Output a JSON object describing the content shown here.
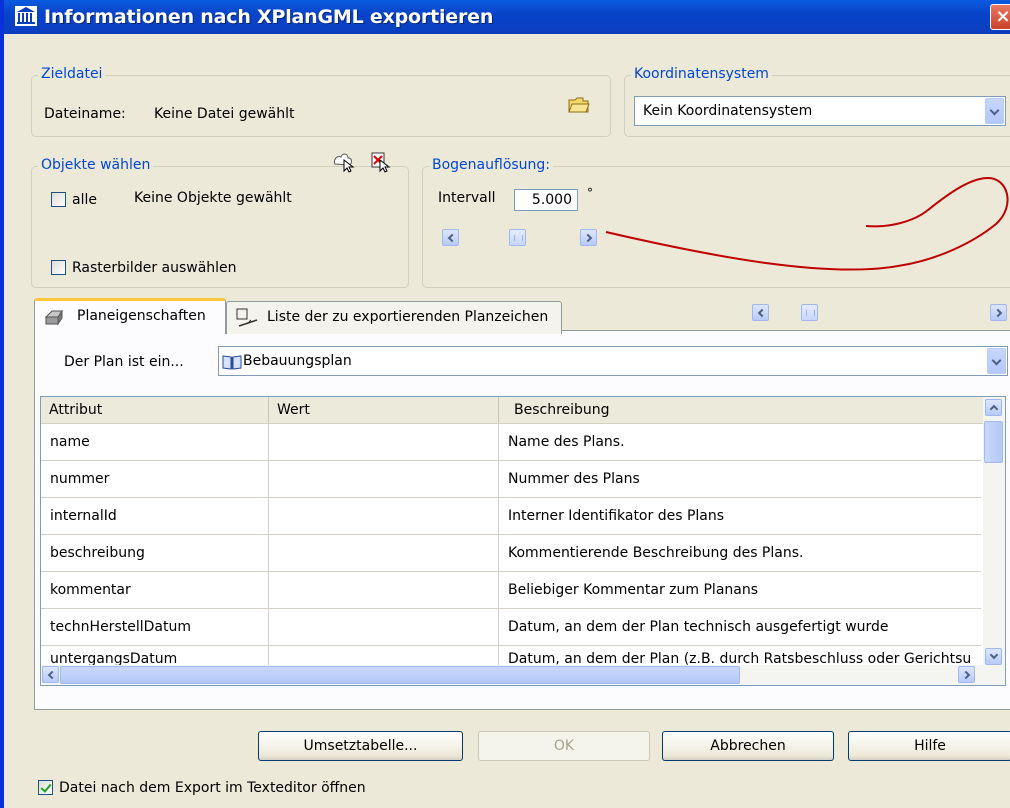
{
  "window": {
    "title": "Informationen nach XPlanGML exportieren",
    "close_label": "×"
  },
  "zieldatei": {
    "group_title": "Zieldatei",
    "dateiname_label": "Dateiname:",
    "dateiname_value": "Keine Datei gewählt"
  },
  "koordinatensystem": {
    "group_title": "Koordinatensystem",
    "selected": "Kein Koordinatensystem"
  },
  "objekte": {
    "group_title": "Objekte wählen",
    "alle_label": "alle",
    "alle_checked": false,
    "status": "Keine Objekte gewählt",
    "rasterbilder_label": "Rasterbilder auswählen",
    "rasterbilder_checked": false
  },
  "bogen": {
    "group_title": "Bogenauflösung:",
    "intervall_label": "Intervall",
    "intervall_value": "5.000",
    "unit": "°"
  },
  "tabs": [
    {
      "label": "Planeigenschaften",
      "active": true
    },
    {
      "label": "Liste der zu exportierenden Planzeichen",
      "active": false
    }
  ],
  "plan": {
    "label": "Der Plan ist ein...",
    "selected": "Bebauungsplan"
  },
  "grid": {
    "columns": [
      "Attribut",
      "Wert",
      "Beschreibung"
    ],
    "rows": [
      {
        "attribut": "name",
        "wert": "",
        "beschreibung": "Name des Plans."
      },
      {
        "attribut": "nummer",
        "wert": "",
        "beschreibung": "Nummer des Plans"
      },
      {
        "attribut": "internalId",
        "wert": "",
        "beschreibung": "Interner Identifikator des Plans"
      },
      {
        "attribut": "beschreibung",
        "wert": "",
        "beschreibung": "Kommentierende Beschreibung des Plans."
      },
      {
        "attribut": "kommentar",
        "wert": "",
        "beschreibung": "Beliebiger Kommentar zum Planans"
      },
      {
        "attribut": "technHerstellDatum",
        "wert": "",
        "beschreibung": "Datum, an dem der Plan technisch ausgefertigt wurde"
      },
      {
        "attribut": "untergangsDatum",
        "wert": "",
        "beschreibung": "Datum, an dem der Plan (z.B. durch Ratsbeschluss oder Gerichtsu"
      }
    ]
  },
  "buttons": {
    "umsetztabelle": "Umsetztabelle...",
    "ok": "OK",
    "abbrechen": "Abbrechen",
    "hilfe": "Hilfe"
  },
  "footer": {
    "texteditor_label": "Datei nach dem Export im Texteditor öffnen",
    "texteditor_checked": true
  },
  "colors": {
    "title_bar": "#0843c9",
    "group_title": "#0046d5",
    "dialog_bg": "#ece9d8",
    "curve": "#c00000"
  }
}
